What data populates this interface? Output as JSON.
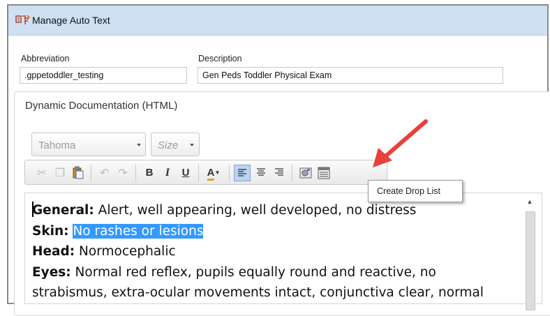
{
  "window": {
    "title": "Manage Auto Text",
    "title_icon": "app-icon"
  },
  "abbreviation": {
    "label": "Abbreviation",
    "value": ".gppetoddler_testing"
  },
  "description": {
    "label": "Description",
    "value": "Gen Peds Toddler Physical Exam"
  },
  "editor_group": {
    "label": "Dynamic Documentation (HTML)"
  },
  "font_select": {
    "value": "Tahoma"
  },
  "size_select": {
    "value": "Size"
  },
  "toolbar": {
    "bold": "B",
    "italic": "I",
    "underline": "U",
    "font_color": "A",
    "buttons": [
      "cut-icon",
      "copy-icon",
      "paste-icon",
      "undo-icon",
      "redo-icon",
      "bold-button",
      "italic-button",
      "underline-button",
      "font-color-button",
      "align-left-button",
      "align-center-button",
      "align-right-button",
      "insert-image-button",
      "create-drop-list-button"
    ]
  },
  "tooltip": {
    "text": "Create Drop List"
  },
  "annotation": {
    "arrow_color": "#e8403a"
  },
  "content": {
    "general_label": "General:",
    "general_text": " Alert, well appearing, well developed, no distress",
    "skin_label": "Skin:",
    "skin_text": "No rashes or lesions",
    "head_label": "Head:",
    "head_text": " Normocephalic",
    "eyes_label": "Eyes:",
    "eyes_text": " Normal red reflex, pupils equally round and reactive, no",
    "eyes_text_2": "strabismus, extra-ocular movements intact, conjunctiva clear, normal"
  },
  "colors": {
    "titlebar": "#cfe0f3",
    "selection": "#3399ff"
  }
}
